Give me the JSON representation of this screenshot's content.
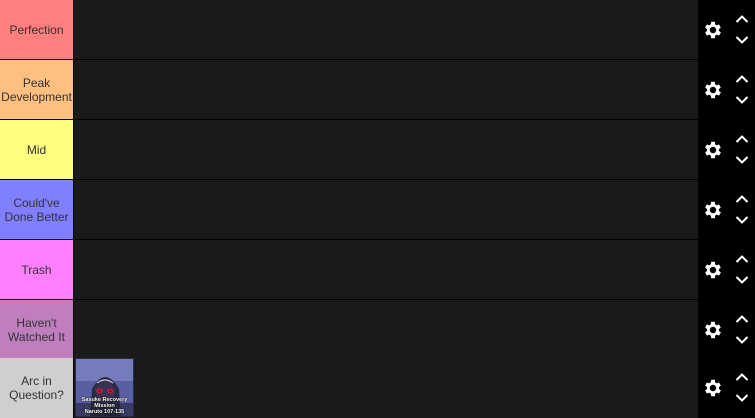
{
  "tiers": [
    {
      "label": "Perfection",
      "color": "#ff7f7f"
    },
    {
      "label": "Peak Development",
      "color": "#ffbf7f"
    },
    {
      "label": "Mid",
      "color": "#ffff7f"
    },
    {
      "label": "Could've Done Better",
      "color": "#7f7fff"
    },
    {
      "label": "Trash",
      "color": "#ff7fff"
    },
    {
      "label": "Haven't Watched It",
      "color": "#bf7fbf"
    },
    {
      "label": "Arc in Question?",
      "color": "#cfcfcf"
    }
  ],
  "items": [
    {
      "tier": 6,
      "line1": "Sasuke Recovery",
      "line2": "Mission",
      "line3": "Naruto 107-135"
    }
  ],
  "controls": {
    "settings_icon": "gear-icon",
    "move_up_icon": "chevron-up-icon",
    "move_down_icon": "chevron-down-icon"
  }
}
